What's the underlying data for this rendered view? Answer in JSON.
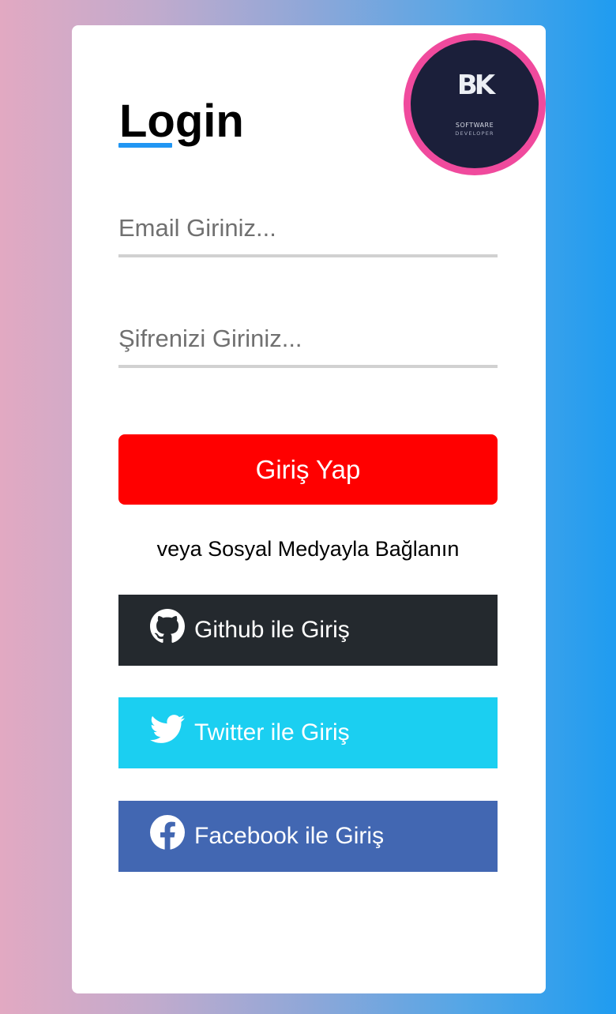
{
  "logo": {
    "mark": "BK",
    "line1": "SOFTWARE",
    "line2": "DEVELOPER",
    "ring_color": "#f04a9d",
    "bg_color": "#1b1f3a"
  },
  "login": {
    "title": "Login",
    "email_placeholder": "Email Giriniz...",
    "password_placeholder": "Şifrenizi Giriniz...",
    "submit_label": "Giriş Yap",
    "submit_color": "#ff0000",
    "accent_color": "#2196f3"
  },
  "social": {
    "heading": "veya Sosyal Medyayla Bağlanın",
    "github": {
      "label": "Github ile Giriş",
      "icon": "github-icon",
      "color": "#24292e"
    },
    "twitter": {
      "label": "Twitter ile Giriş",
      "icon": "twitter-icon",
      "color": "#1bcff1"
    },
    "facebook": {
      "label": "Facebook ile Giriş",
      "icon": "facebook-icon",
      "color": "#4267b2"
    }
  }
}
